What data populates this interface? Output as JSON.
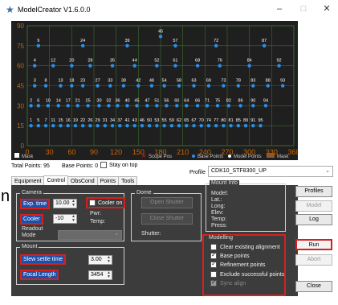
{
  "window": {
    "title": "ModelCreator V1.6.0.0",
    "minimize": "–",
    "maximize": "□",
    "close": "✕"
  },
  "chart_data": {
    "type": "scatter",
    "x_ticks": [
      "0",
      "30",
      "60",
      "90",
      "120",
      "150",
      "180",
      "210",
      "240",
      "270",
      "300",
      "330",
      "360"
    ],
    "y_ticks": [
      "90",
      "75",
      "60",
      "45",
      "30",
      "15",
      "0"
    ],
    "xlim": [
      0,
      360
    ],
    "ylim": [
      0,
      90
    ],
    "grid": true,
    "rows": [
      {
        "alt": 85,
        "labels": [
          {
            "n": "45",
            "az": 180
          }
        ]
      },
      {
        "alt": 78,
        "labels": [
          {
            "n": "9",
            "az": 15
          },
          {
            "n": "24",
            "az": 75
          },
          {
            "n": "39",
            "az": 135
          },
          {
            "n": "57",
            "az": 200
          },
          {
            "n": "72",
            "az": 255
          },
          {
            "n": "87",
            "az": 320
          }
        ]
      },
      {
        "alt": 63,
        "labels": [
          {
            "n": "4",
            "az": 10
          },
          {
            "n": "12",
            "az": 35
          },
          {
            "n": "20",
            "az": 60
          },
          {
            "n": "28",
            "az": 85
          },
          {
            "n": "35",
            "az": 115
          },
          {
            "n": "44",
            "az": 145
          },
          {
            "n": "52",
            "az": 175
          },
          {
            "n": "61",
            "az": 200
          },
          {
            "n": "68",
            "az": 230
          },
          {
            "n": "76",
            "az": 260
          },
          {
            "n": "84",
            "az": 300
          },
          {
            "n": "92",
            "az": 340
          }
        ]
      },
      {
        "alt": 48,
        "labels": [
          {
            "n": "3",
            "az": 10
          },
          {
            "n": "8",
            "az": 25
          },
          {
            "n": "13",
            "az": 45
          },
          {
            "n": "18",
            "az": 60
          },
          {
            "n": "23",
            "az": 75
          },
          {
            "n": "27",
            "az": 95
          },
          {
            "n": "33",
            "az": 112
          },
          {
            "n": "38",
            "az": 130
          },
          {
            "n": "42",
            "az": 150
          },
          {
            "n": "48",
            "az": 168
          },
          {
            "n": "54",
            "az": 185
          },
          {
            "n": "58",
            "az": 205
          },
          {
            "n": "63",
            "az": 225
          },
          {
            "n": "69",
            "az": 245
          },
          {
            "n": "73",
            "az": 265
          },
          {
            "n": "78",
            "az": 285
          },
          {
            "n": "83",
            "az": 305
          },
          {
            "n": "88",
            "az": 325
          },
          {
            "n": "93",
            "az": 345
          }
        ]
      },
      {
        "alt": 33,
        "labels": [
          {
            "n": "2",
            "az": 5
          },
          {
            "n": "6",
            "az": 15
          },
          {
            "n": "10",
            "az": 28
          },
          {
            "n": "14",
            "az": 42
          },
          {
            "n": "17",
            "az": 55
          },
          {
            "n": "21",
            "az": 68
          },
          {
            "n": "25",
            "az": 82
          },
          {
            "n": "30",
            "az": 97
          },
          {
            "n": "32",
            "az": 110
          },
          {
            "n": "36",
            "az": 122
          },
          {
            "n": "40",
            "az": 135
          },
          {
            "n": "45",
            "az": 148
          },
          {
            "n": "47",
            "az": 162
          },
          {
            "n": "51",
            "az": 175
          },
          {
            "n": "56",
            "az": 188
          },
          {
            "n": "60",
            "az": 202
          },
          {
            "n": "64",
            "az": 215
          },
          {
            "n": "66",
            "az": 230
          },
          {
            "n": "71",
            "az": 243
          },
          {
            "n": "75",
            "az": 257
          },
          {
            "n": "82",
            "az": 272
          },
          {
            "n": "86",
            "az": 288
          },
          {
            "n": "90",
            "az": 305
          },
          {
            "n": "94",
            "az": 322
          }
        ]
      },
      {
        "alt": 18,
        "labels": [
          {
            "n": "1",
            "az": 5
          },
          {
            "n": "5",
            "az": 15
          },
          {
            "n": "7",
            "az": 25
          },
          {
            "n": "11",
            "az": 35
          },
          {
            "n": "15",
            "az": 45
          },
          {
            "n": "16",
            "az": 55
          },
          {
            "n": "19",
            "az": 65
          },
          {
            "n": "22",
            "az": 75
          },
          {
            "n": "26",
            "az": 85
          },
          {
            "n": "29",
            "az": 95
          },
          {
            "n": "31",
            "az": 105
          },
          {
            "n": "34",
            "az": 115
          },
          {
            "n": "37",
            "az": 125
          },
          {
            "n": "41",
            "az": 135
          },
          {
            "n": "43",
            "az": 145
          },
          {
            "n": "46",
            "az": 155
          },
          {
            "n": "50",
            "az": 165
          },
          {
            "n": "53",
            "az": 175
          },
          {
            "n": "55",
            "az": 185
          },
          {
            "n": "59",
            "az": 195
          },
          {
            "n": "62",
            "az": 205
          },
          {
            "n": "65",
            "az": 215
          },
          {
            "n": "67",
            "az": 225
          },
          {
            "n": "70",
            "az": 235
          },
          {
            "n": "74",
            "az": 245
          },
          {
            "n": "77",
            "az": 255
          },
          {
            "n": "80",
            "az": 265
          },
          {
            "n": "81",
            "az": 275
          },
          {
            "n": "85",
            "az": 285
          },
          {
            "n": "89",
            "az": 295
          },
          {
            "n": "91",
            "az": 305
          },
          {
            "n": "95",
            "az": 315
          }
        ]
      }
    ],
    "legend": {
      "mask": "Mask",
      "scope_pos": "Scope Pos",
      "base_points": "Base Points",
      "model_points": "Model Points",
      "mask_right": "Mask"
    },
    "colors": {
      "background": "#1f1f1f",
      "grid": "#3c6b2c",
      "point": "#2b8fe8",
      "tick": "#cc6600",
      "scope": "#d62020"
    }
  },
  "status": {
    "total_points": "Total Points: 95",
    "base_points": "Base Points: 0",
    "stay_on_top": "Stay on top"
  },
  "profile": {
    "label": "Profile",
    "value": "CDK10_STF8300_UP"
  },
  "tabs": [
    "Equipment",
    "Control",
    "ObsCond",
    "Points",
    "Tools"
  ],
  "camera": {
    "group": "Camera",
    "exp_time_label": "Exp. time",
    "exp_time_value": "10.00",
    "cooler_on": "Cooler on",
    "cooler_label": "Cooler",
    "cooler_value": "-10",
    "pwr_label": "Pwr:",
    "temp_label": "Temp:",
    "readout_label": "Readout Mode"
  },
  "dome": {
    "group": "Dome",
    "open_shutter": "Open Shutter",
    "close_shutter": "Close Shutter",
    "shutter_label": "Shutter:"
  },
  "mount": {
    "group": "Mount",
    "slew_settle_label": "Slew settle time",
    "slew_settle_value": "3.00",
    "focal_length_label": "Focal Length",
    "focal_length_value": "3454"
  },
  "mount_info": {
    "group": "Mount Info",
    "model": "Model:",
    "lat": "Lat.:",
    "long": "Long:",
    "elev": "Elev:",
    "temp": "Temp:",
    "press": "Press:"
  },
  "modelling": {
    "group": "Modelling",
    "options": [
      {
        "label": "Clear existing alignment",
        "checked": false,
        "enabled": true
      },
      {
        "label": "Base points",
        "checked": true,
        "enabled": true
      },
      {
        "label": "Refinement points",
        "checked": true,
        "enabled": true
      },
      {
        "label": "Exclude successful points",
        "checked": false,
        "enabled": true
      },
      {
        "label": "Sync align",
        "checked": true,
        "enabled": false
      }
    ]
  },
  "buttons": {
    "profiles": "Profiles",
    "model": "Model",
    "log": "Log",
    "run": "Run",
    "abort": "Abort",
    "close": "Close"
  }
}
